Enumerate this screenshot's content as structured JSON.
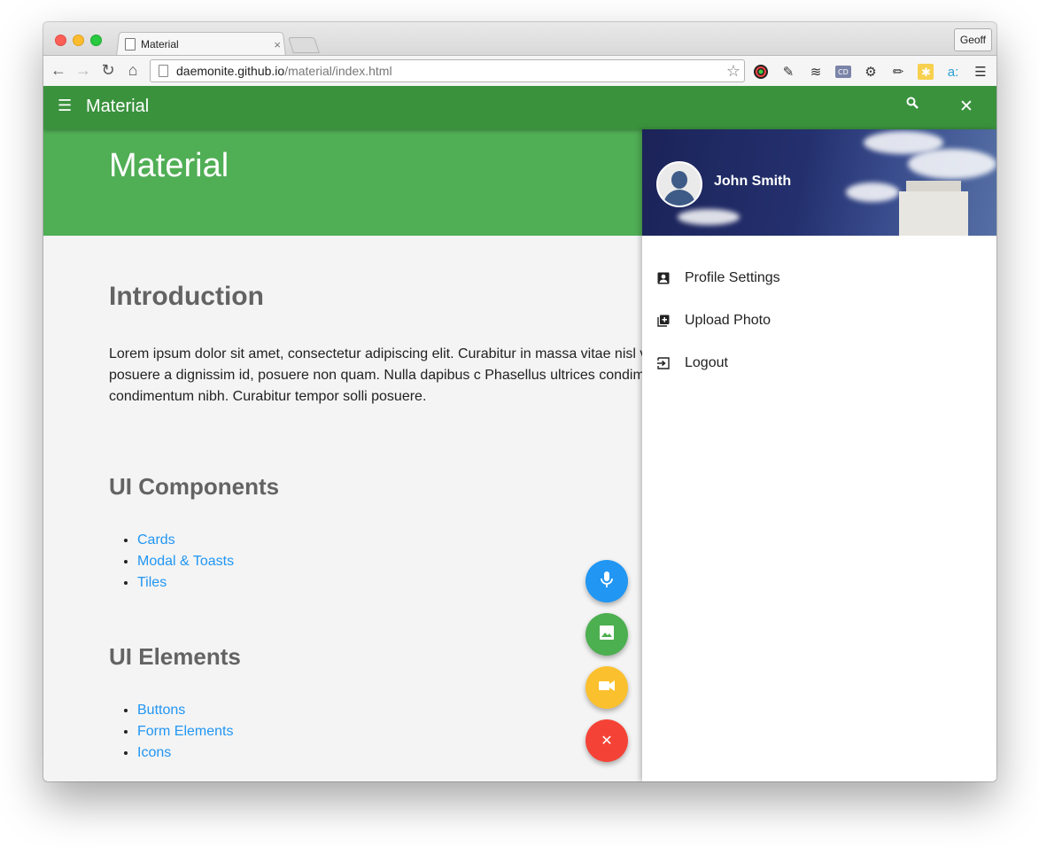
{
  "browser": {
    "tab_title": "Material",
    "tab_close": "×",
    "profile_name": "Geoff",
    "url_host": "daemonite.github.io",
    "url_path": "/material/index.html"
  },
  "appbar": {
    "title": "Material"
  },
  "hero": {
    "title": "Material"
  },
  "content": {
    "intro_heading": "Introduction",
    "intro_text": "Lorem ipsum dolor sit amet, consectetur adipiscing elit. Curabitur in massa vitae nisl vel purus. Quisque leo est, posuere a dignissim id, posuere non quam. Nulla dapibus c Phasellus ultrices condimentum dolor, non condimentum nibh. Curabitur tempor solli posuere.",
    "components_heading": "UI Components",
    "components": [
      "Cards",
      "Modal & Toasts",
      "Tiles"
    ],
    "elements_heading": "UI Elements",
    "elements": [
      "Buttons",
      "Form Elements",
      "Icons"
    ]
  },
  "fabs": [
    {
      "icon": "mic-icon",
      "color": "#2196f3"
    },
    {
      "icon": "image-icon",
      "color": "#4caf50"
    },
    {
      "icon": "videocam-icon",
      "color": "#fbc02d"
    },
    {
      "icon": "close-icon",
      "color": "#f44336"
    }
  ],
  "drawer": {
    "user_name": "John Smith",
    "items": [
      {
        "label": "Profile Settings",
        "icon": "account-box-icon"
      },
      {
        "label": "Upload Photo",
        "icon": "add-photo-icon"
      },
      {
        "label": "Logout",
        "icon": "exit-icon"
      }
    ]
  },
  "colors": {
    "appbar": "#3a923d",
    "hero": "#50ae55",
    "link": "#2196f3"
  }
}
